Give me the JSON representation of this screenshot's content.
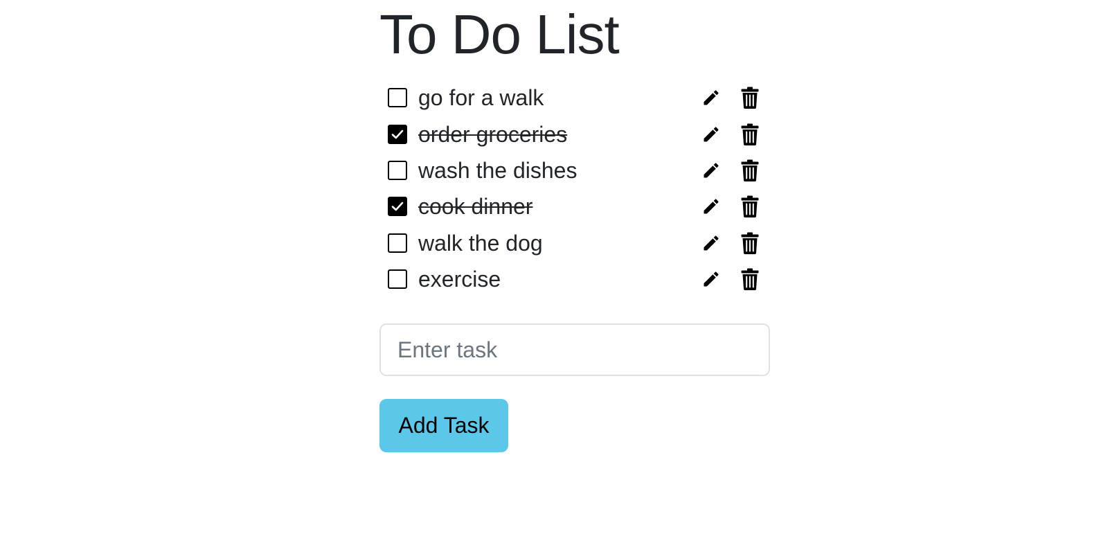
{
  "page": {
    "title": "To Do List"
  },
  "tasks": [
    {
      "text": "go for a walk",
      "completed": false
    },
    {
      "text": "order groceries",
      "completed": true
    },
    {
      "text": "wash the dishes",
      "completed": false
    },
    {
      "text": "cook dinner",
      "completed": true
    },
    {
      "text": "walk the dog",
      "completed": false
    },
    {
      "text": "exercise",
      "completed": false
    }
  ],
  "task_actions": {
    "edit_icon": "pencil-icon",
    "delete_icon": "trash-icon"
  },
  "new_task": {
    "value": "",
    "placeholder": "Enter task"
  },
  "add_button": {
    "label": "Add Task",
    "color": "#5bc8ea"
  }
}
